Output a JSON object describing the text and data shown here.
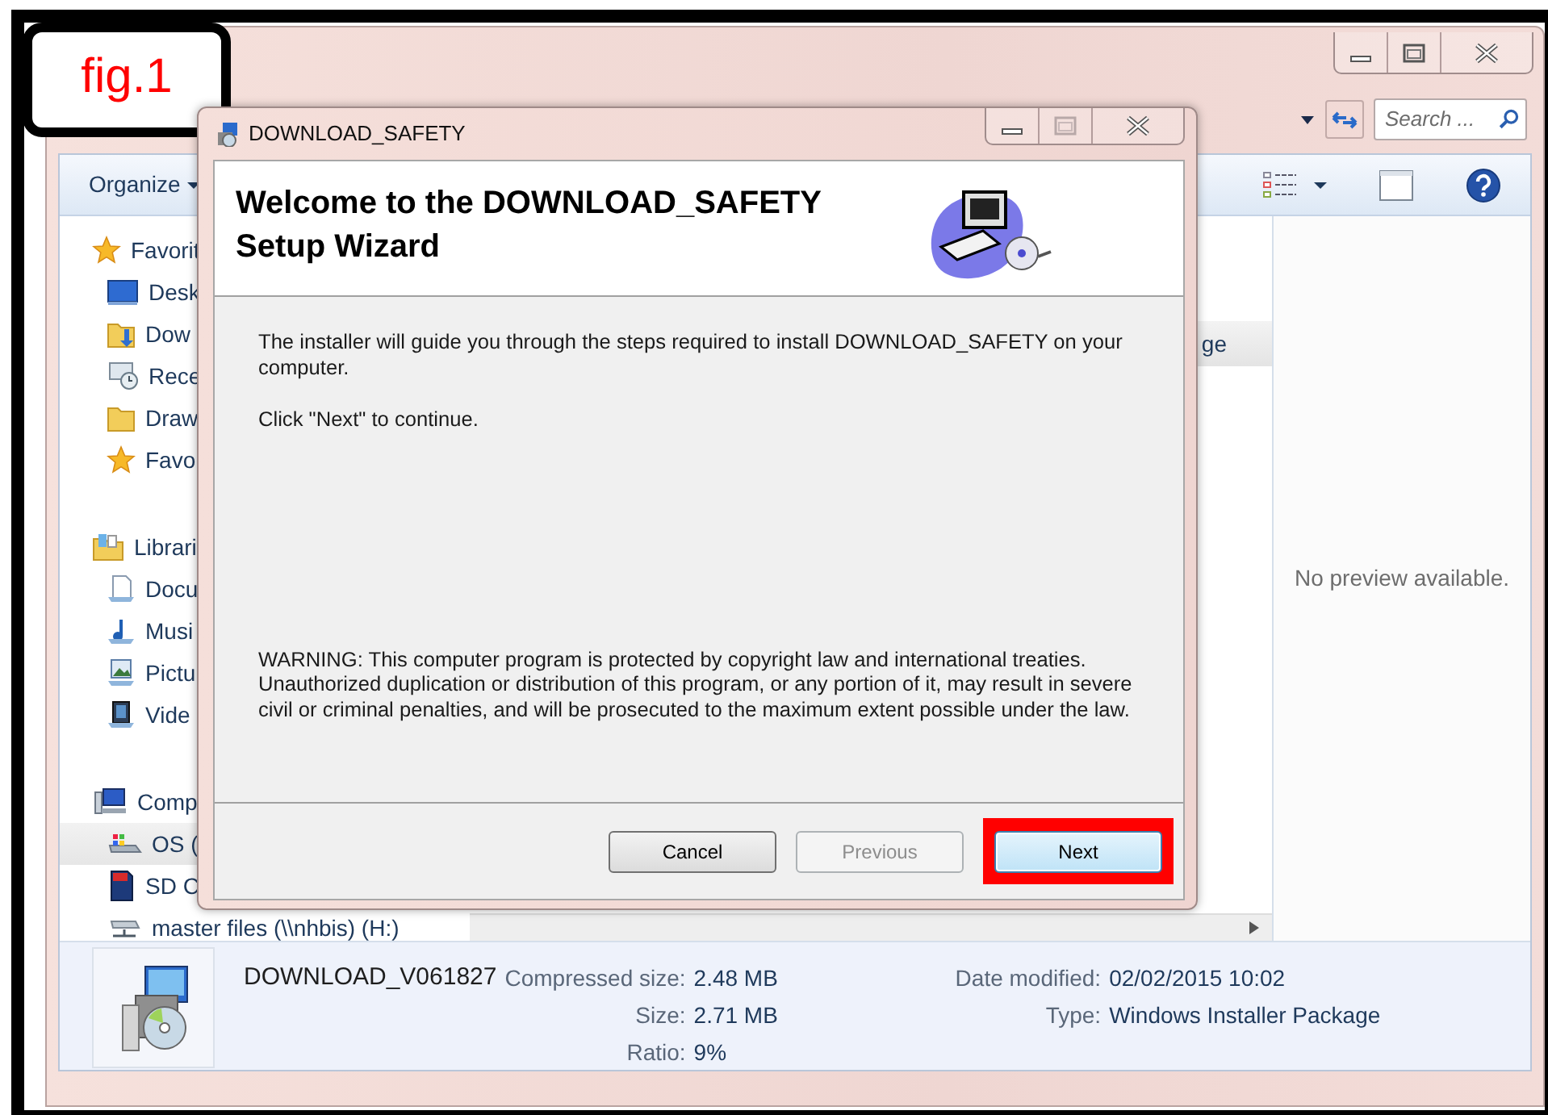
{
  "figure_label": "fig.1",
  "explorer": {
    "search": {
      "placeholder": "Search ..."
    },
    "organize": "Organize",
    "sidebar": [
      {
        "label": "Favorit",
        "kind": "favorites",
        "selected": false,
        "children": [
          {
            "label": "Desk",
            "kind": "desktop",
            "selected": false
          },
          {
            "label": "Dow",
            "kind": "downloads",
            "selected": false
          },
          {
            "label": "Rece",
            "kind": "recent",
            "selected": false
          },
          {
            "label": "Draw",
            "kind": "folder",
            "selected": false
          },
          {
            "label": "Favo",
            "kind": "favorites",
            "selected": false
          }
        ]
      },
      {
        "label": "Librari",
        "kind": "libraries",
        "selected": false,
        "children": [
          {
            "label": "Docu",
            "kind": "documents",
            "selected": false
          },
          {
            "label": "Musi",
            "kind": "music",
            "selected": false
          },
          {
            "label": "Pictu",
            "kind": "pictures",
            "selected": false
          },
          {
            "label": "Vide",
            "kind": "videos",
            "selected": false
          }
        ]
      },
      {
        "label": "Comp",
        "kind": "computer",
        "selected": false,
        "children": [
          {
            "label": "OS (",
            "kind": "drive",
            "selected": true
          },
          {
            "label": "SD C",
            "kind": "sdcard",
            "selected": false
          },
          {
            "label": "master files (\\\\nhbis) (H:)",
            "kind": "network",
            "selected": false
          }
        ]
      }
    ],
    "file_list": {
      "column_fragment": "ge"
    },
    "preview": "No preview available.",
    "details": {
      "file_name": "DOWNLOAD_V061827",
      "left_fields": [
        {
          "label": "Compressed size:",
          "value": "2.48 MB"
        },
        {
          "label": "Size:",
          "value": "2.71 MB"
        },
        {
          "label": "Ratio:",
          "value": "9%"
        }
      ],
      "right_fields": [
        {
          "label": "Date modified:",
          "value": "02/02/2015 10:02"
        },
        {
          "label": "Type:",
          "value": "Windows Installer Package"
        }
      ]
    }
  },
  "dialog": {
    "title": "DOWNLOAD_SAFETY",
    "heading": "Welcome to the DOWNLOAD_SAFETY Setup Wizard",
    "paragraphs": [
      "The installer will guide you through the steps required to install DOWNLOAD_SAFETY on your computer.",
      "Click \"Next\" to continue."
    ],
    "warning": "WARNING: This computer program is protected by copyright law and international treaties. Unauthorized duplication or distribution of this program, or any portion of it, may result in severe civil or criminal penalties, and will be prosecuted to the maximum extent possible under the law.",
    "buttons": [
      {
        "label": "Cancel",
        "disabled": false,
        "highlighted": false
      },
      {
        "label": "Previous",
        "disabled": true,
        "highlighted": false
      },
      {
        "label": "Next",
        "disabled": false,
        "highlighted": true
      }
    ]
  }
}
